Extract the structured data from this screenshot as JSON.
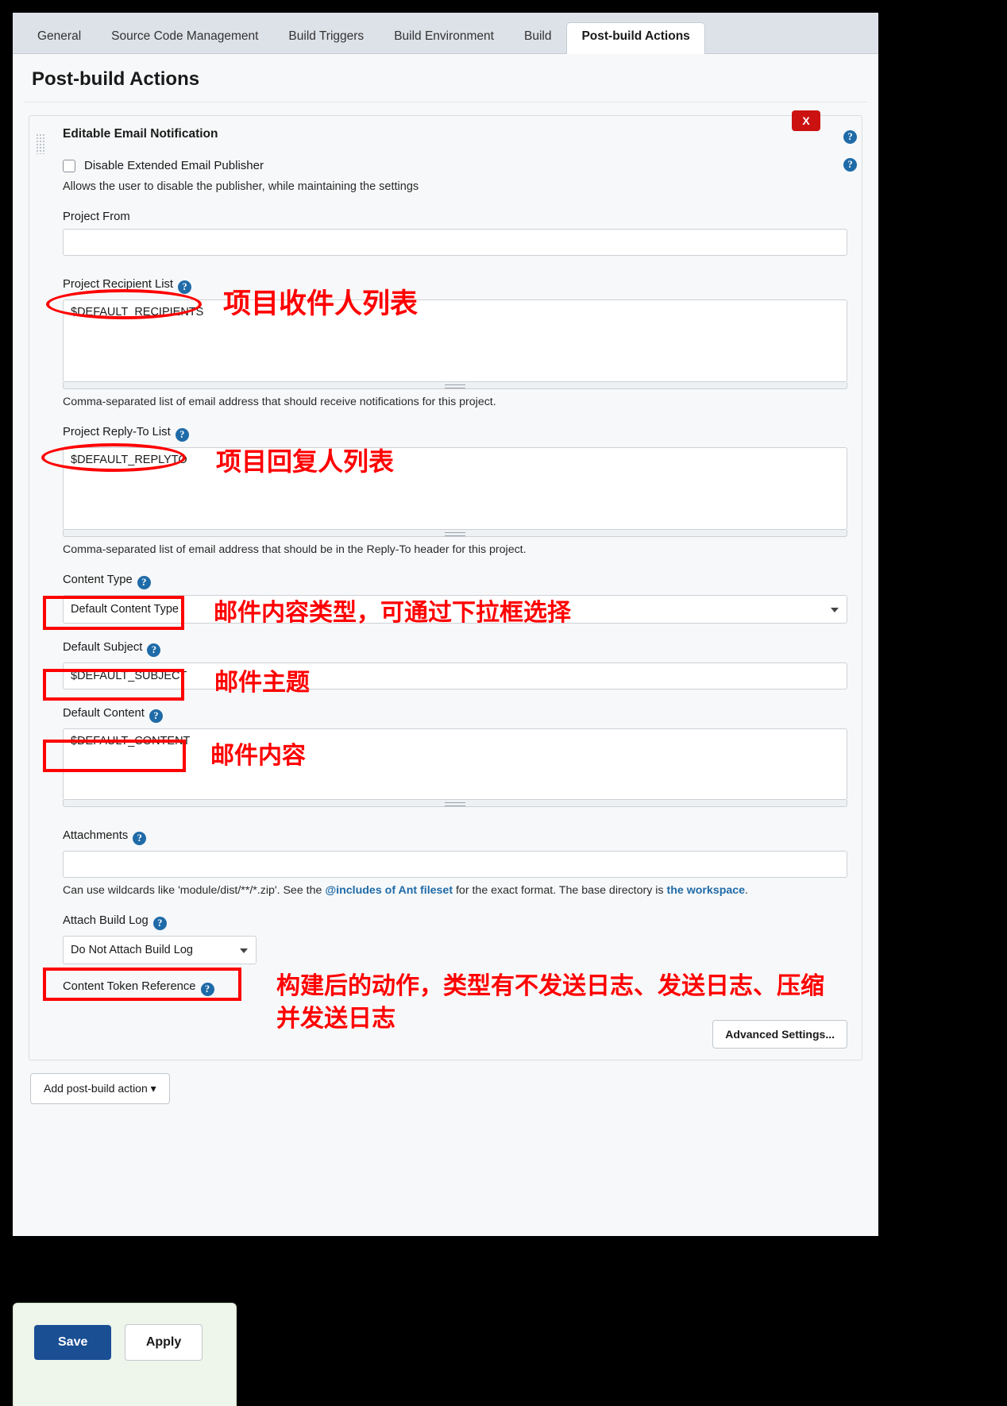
{
  "tabs": [
    {
      "label": "General",
      "active": false
    },
    {
      "label": "Source Code Management",
      "active": false
    },
    {
      "label": "Build Triggers",
      "active": false
    },
    {
      "label": "Build Environment",
      "active": false
    },
    {
      "label": "Build",
      "active": false
    },
    {
      "label": "Post-build Actions",
      "active": true
    }
  ],
  "page": {
    "title": "Post-build Actions"
  },
  "block": {
    "title": "Editable Email Notification",
    "close_label": "X",
    "help_glyph": "?",
    "disable_checkbox_label": "Disable Extended Email Publisher",
    "disable_note": "Allows the user to disable the publisher, while maintaining the settings",
    "fields": {
      "project_from": {
        "label": "Project From",
        "value": "",
        "placeholder": ""
      },
      "recipient_list": {
        "label": "Project Recipient List",
        "value": "$DEFAULT_RECIPIENTS",
        "hint": "Comma-separated list of email address that should receive notifications for this project."
      },
      "reply_to_list": {
        "label": "Project Reply-To List",
        "value": "$DEFAULT_REPLYTO",
        "hint": "Comma-separated list of email address that should be in the Reply-To header for this project."
      },
      "content_type": {
        "label": "Content Type",
        "value": "Default Content Type"
      },
      "default_subject": {
        "label": "Default Subject",
        "value": "$DEFAULT_SUBJECT"
      },
      "default_content": {
        "label": "Default Content",
        "value": "$DEFAULT_CONTENT"
      },
      "attachments": {
        "label": "Attachments",
        "value": "",
        "hint_part1": "Can use wildcards like 'module/dist/**/*.zip'. See the ",
        "hint_link1": "@includes of Ant fileset",
        "hint_part2": " for the exact format. The base directory is ",
        "hint_link2": "the workspace",
        "hint_part3": "."
      },
      "attach_build_log": {
        "label": "Attach Build Log",
        "value": "Do Not Attach Build Log"
      },
      "content_token_reference": {
        "label": "Content Token Reference"
      }
    },
    "advanced_button": "Advanced Settings..."
  },
  "add_post_build_action": "Add post-build action",
  "footer": {
    "save": "Save",
    "apply": "Apply"
  },
  "annotations": [
    {
      "id": "a1",
      "text": "项目收件人列表"
    },
    {
      "id": "a2",
      "text": "项目回复人列表"
    },
    {
      "id": "a3",
      "text": "邮件内容类型，可通过下拉框选择"
    },
    {
      "id": "a4",
      "text": "邮件主题"
    },
    {
      "id": "a5",
      "text": "邮件内容"
    },
    {
      "id": "a6",
      "text": "构建后的动作，类型有不发送日志、发送日志、压缩\n并发送日志"
    }
  ],
  "colors": {
    "annotation_red": "#ff0000",
    "close_red": "#cc1111",
    "help_blue": "#1f6ba8",
    "save_blue": "#1a4f94",
    "link_blue": "#1f6ba8"
  }
}
